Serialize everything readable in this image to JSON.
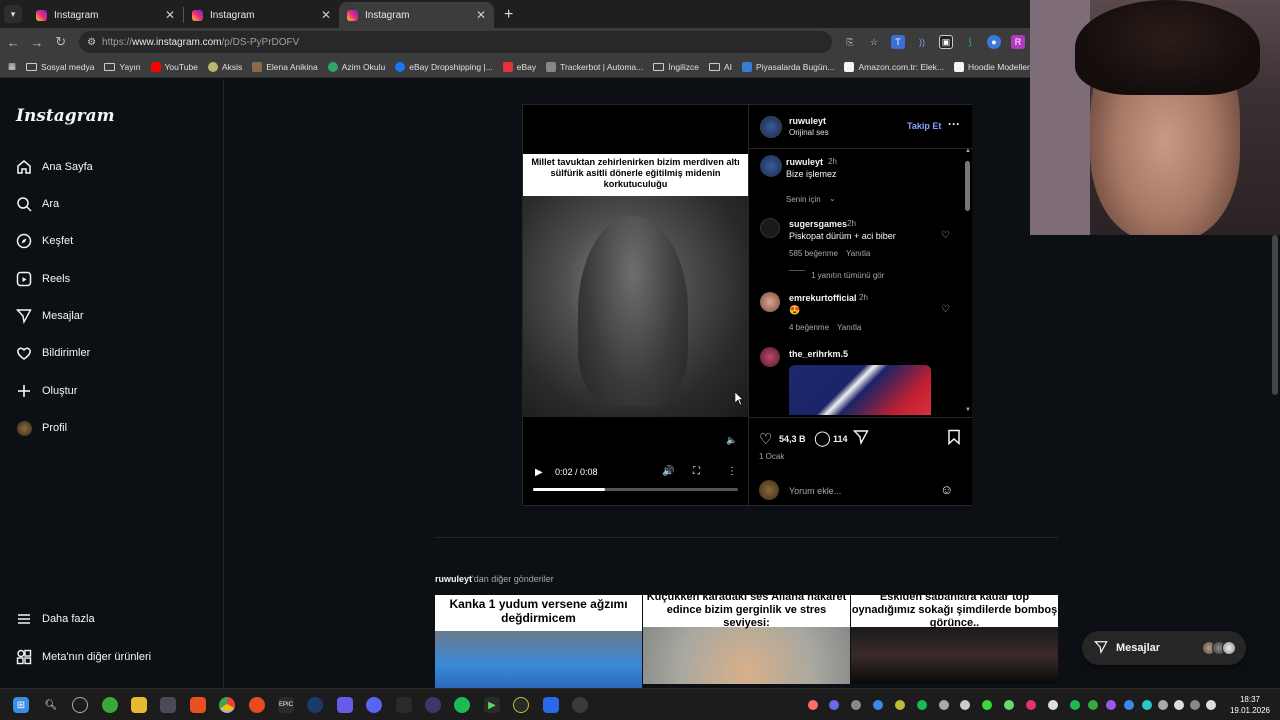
{
  "browser": {
    "tabs": [
      {
        "title": "Instagram",
        "active": false
      },
      {
        "title": "Instagram",
        "active": false
      },
      {
        "title": "Instagram",
        "active": true
      }
    ],
    "url_prefix": "https://",
    "url_host": "www.instagram.com",
    "url_path": "/p/DS-PyPrDOFV",
    "bookmarks": [
      {
        "label": "Sosyal medya",
        "icon": "folder-icon"
      },
      {
        "label": "Yayın",
        "icon": "folder-icon"
      },
      {
        "label": "YouTube",
        "icon": "youtube-icon",
        "color": "#ff0000"
      },
      {
        "label": "Aksis",
        "icon": "aksis-icon",
        "color": "#b8b86a"
      },
      {
        "label": "Elena Anikina",
        "icon": "person-icon",
        "color": "#8a6a4a"
      },
      {
        "label": "Azim Okulu",
        "icon": "azim-icon",
        "color": "#2ea66a"
      },
      {
        "label": "eBay Dropshipping |...",
        "icon": "facebook-icon",
        "color": "#1877f2"
      },
      {
        "label": "eBay",
        "icon": "ebay-icon",
        "color": "#e53238"
      },
      {
        "label": "Trackerbot | Automa...",
        "icon": "trackerbot-icon",
        "color": "#888888"
      },
      {
        "label": "İngilizce",
        "icon": "folder-icon"
      },
      {
        "label": "AI",
        "icon": "folder-icon"
      },
      {
        "label": "Piyasalarda Bugün...",
        "icon": "chart-icon",
        "color": "#3a7bd5"
      },
      {
        "label": "Amazon.com.tr: Elek...",
        "icon": "amazon-icon",
        "color": "#f5f5f5"
      },
      {
        "label": "Hoodie Modelleri |",
        "icon": "hoodie-icon",
        "color": "#f5f5f5"
      }
    ]
  },
  "sidebar": {
    "logo": "Instagram",
    "items": [
      {
        "label": "Ana Sayfa",
        "icon": "home-icon"
      },
      {
        "label": "Ara",
        "icon": "search-icon"
      },
      {
        "label": "Keşfet",
        "icon": "compass-icon"
      },
      {
        "label": "Reels",
        "icon": "reels-icon"
      },
      {
        "label": "Mesajlar",
        "icon": "messages-icon"
      },
      {
        "label": "Bildirimler",
        "icon": "heart-icon"
      },
      {
        "label": "Oluştur",
        "icon": "plus-icon"
      },
      {
        "label": "Profil",
        "icon": "profile-avatar-icon"
      }
    ],
    "bottom": [
      {
        "label": "Daha fazla",
        "icon": "menu-icon"
      },
      {
        "label": "Meta'nın diğer ürünleri",
        "icon": "meta-products-icon"
      }
    ]
  },
  "post": {
    "video_caption": "Millet tavuktan zehirlenirken bizim merdiven altı sülfürik asitli dönerle eğitilmiş midenin korkutuculuğu",
    "video_time": "0:02 / 0:08",
    "progress": 0.35,
    "author": "ruwuleyt",
    "audio": "Orijinal ses",
    "follow_label": "Takip Et",
    "caption_comment": {
      "user": "ruwuleyt",
      "time": "2h",
      "text": "Bize işlemez"
    },
    "for_you": "Senin için",
    "comments": [
      {
        "user": "sugersgames",
        "time": "2h",
        "text": "Piskopat dürüm + aci biber",
        "likes": "585 beğenme",
        "reply": "Yanıtla",
        "view_replies": "1 yanıtın tümünü gör"
      },
      {
        "user": "emrekurtofficial",
        "time": "2h",
        "text": "😍",
        "likes": "4 beğenme",
        "reply": "Yanıtla"
      },
      {
        "user": "the_erihrkm.5",
        "time": "",
        "text": ""
      }
    ],
    "like_count": "54,3 B",
    "comment_count": "114",
    "date": "1 Ocak",
    "comment_placeholder": "Yorum ekle..."
  },
  "more_posts": {
    "user": "ruwuleyt",
    "suffix": "'dan diğer gönderiler",
    "thumbs": [
      {
        "caption": "Kanka 1 yudum versene ağzımı değdirmicem"
      },
      {
        "caption": "Küçükken karadaki ses Allaha hakaret edince bizim gerginlik ve stres seviyesi:"
      },
      {
        "caption": "Eskiden sabahlara kadar top oynadığımız sokağı şimdilerde bomboş görünce.."
      }
    ]
  },
  "messages_pill": {
    "label": "Mesajlar"
  },
  "taskbar": {
    "time": "18:37",
    "date": "19.01.2026"
  },
  "colors": {
    "background": "#0c1014",
    "link_blue": "#85a1ff",
    "border": "#262626"
  }
}
